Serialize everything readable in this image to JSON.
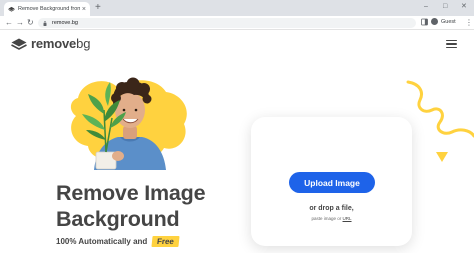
{
  "browser": {
    "tab_title": "Remove Background from Im",
    "new_tab_glyph": "+",
    "url": "remove.bg",
    "profile_label": "Guest",
    "nav_back": "←",
    "nav_forward": "→",
    "reload": "↻",
    "minimize": "–",
    "maximize": "□",
    "close": "✕",
    "tab_close": "×",
    "menu": "⋮"
  },
  "site": {
    "logo_word": "remove",
    "logo_suffix": "bg"
  },
  "hero": {
    "headline_line1": "Remove Image",
    "headline_line2": "Background",
    "subline": "100% Automatically and",
    "free_badge": "Free"
  },
  "upload": {
    "button_label": "Upload Image",
    "drop_text": "or drop a file,",
    "paste_prefix": "paste image or",
    "paste_url": "URL"
  },
  "colors": {
    "accent_blue": "#1e63e9",
    "accent_yellow": "#ffd23f",
    "text_dark": "#454545"
  }
}
